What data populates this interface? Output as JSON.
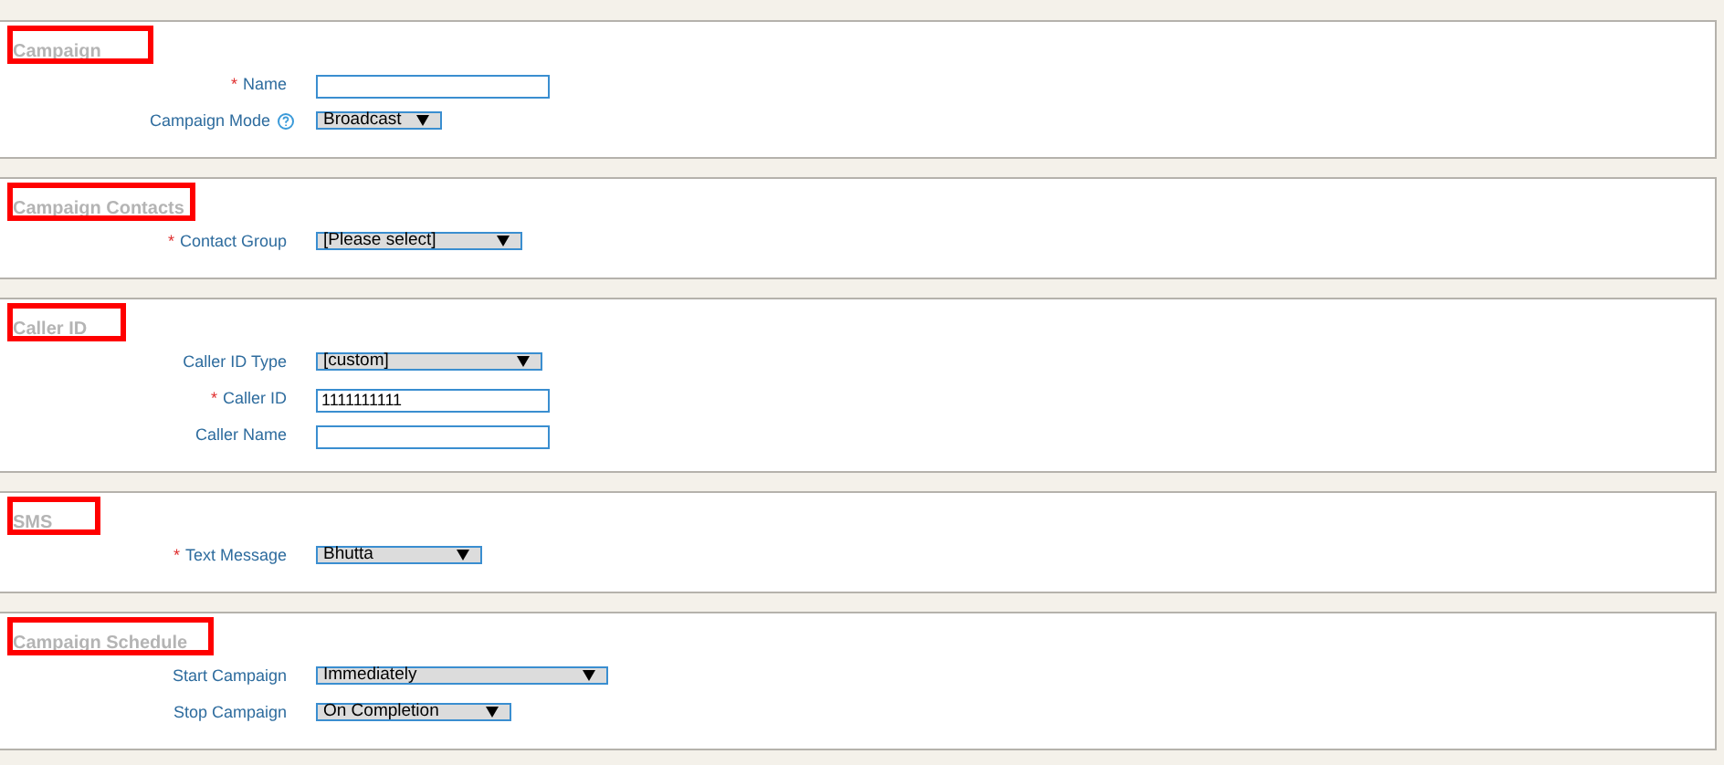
{
  "sections": [
    {
      "title": "Campaign",
      "highlighted": true,
      "fields": [
        {
          "label": "Name",
          "marker": "*",
          "help": false,
          "kind": "text"
        },
        {
          "label": "Campaign Mode",
          "help": true,
          "kind": "select",
          "value": "Broadcast"
        }
      ]
    },
    {
      "title": "Campaign Contacts",
      "highlighted": true,
      "fields": [
        {
          "label": "Contact Group",
          "marker": "*",
          "help": false,
          "kind": "select",
          "value": "[Please select]"
        }
      ]
    },
    {
      "title": "Caller ID",
      "highlighted": true,
      "fields": [
        {
          "label": "Caller ID Type",
          "help": false,
          "kind": "select",
          "value": "[custom]"
        },
        {
          "label": "Caller ID",
          "marker": "*",
          "help": false,
          "kind": "text",
          "value": "1111111111"
        },
        {
          "label": "Caller Name",
          "help": false,
          "kind": "text"
        }
      ]
    },
    {
      "title": "SMS",
      "highlighted": true,
      "fields": [
        {
          "label": "Text Message",
          "marker": "*",
          "help": false,
          "kind": "select",
          "value": "Bhutta"
        }
      ]
    },
    {
      "title": "Campaign Schedule",
      "highlighted": true,
      "fields": [
        {
          "label": "Start Campaign",
          "help": false,
          "kind": "select",
          "value": "Immediately"
        },
        {
          "label": "Stop Campaign",
          "help": false,
          "kind": "select",
          "value": "On Completion"
        }
      ]
    }
  ]
}
